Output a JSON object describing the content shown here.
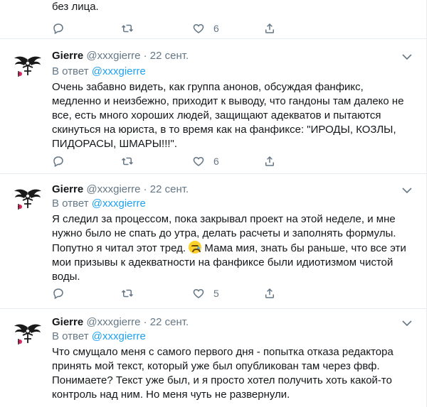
{
  "top_tweet": {
    "text_tail": "без лица.",
    "likes": "6"
  },
  "tweets": [
    {
      "name": "Gierre",
      "handle": "@xxxgierre",
      "dot": "·",
      "date": "22 сент.",
      "reply_prefix": "В ответ",
      "reply_to": "@xxxgierre",
      "text": "Очень забавно видеть, как группа анонов, обсуждая фанфикс, медленно и неизбежно, приходит к выводу, что гандоны там далеко не все, есть много хороших людей, защищают адекватов и пытаются скинуться на юриста, в то время как на фанфиксе: \"ИРОДЫ, КОЗЛЫ, ПИДОРАСЫ, ШМАРЫ!!!\".",
      "likes": "6"
    },
    {
      "name": "Gierre",
      "handle": "@xxxgierre",
      "dot": "·",
      "date": "22 сент.",
      "reply_prefix": "В ответ",
      "reply_to": "@xxxgierre",
      "text_before_emoji": "Я следил за процессом, пока закрывал проект на этой неделе, и мне нужно было не спать до утра, делать расчеты и заполнять формулы. Попутно я читал этот тред.",
      "text_after_emoji": " Мама мия, знать бы раньше, что все эти мои призывы к адекватности на фанфиксе были идиотизмом чистой воды.",
      "likes": "5"
    },
    {
      "name": "Gierre",
      "handle": "@xxxgierre",
      "dot": "·",
      "date": "22 сент.",
      "reply_prefix": "В ответ",
      "reply_to": "@xxxgierre",
      "text": "Что смущало меня с самого первого дня - попытка отказа редактора принять мой текст, который уже был опубликован там через фвф. Понимаете? Текст уже был, и я просто хотел получить хоть какой-то контроль над ним. Но меня чуть не развернули."
    }
  ],
  "icons": {
    "reply": "reply-icon",
    "retweet": "retweet-icon",
    "like": "heart-icon",
    "share": "share-icon",
    "caret": "chevron-down-icon",
    "avatar": "winged-emblem-avatar"
  },
  "colors": {
    "text": "#14171a",
    "secondary": "#657786",
    "link": "#1da1f2",
    "border": "#e6ecf0"
  }
}
